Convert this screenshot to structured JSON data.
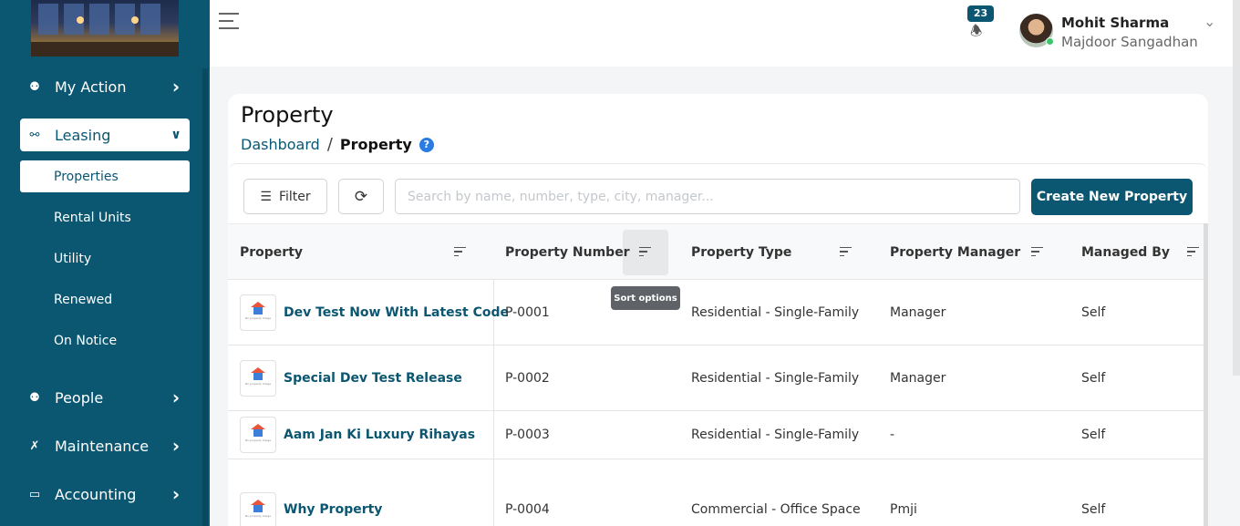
{
  "sidebar": {
    "nav": [
      {
        "label": "My Action",
        "icon": "user-icon"
      },
      {
        "label": "Leasing",
        "icon": "lock-icon"
      },
      {
        "label": "People",
        "icon": "people-icon"
      },
      {
        "label": "Maintenance",
        "icon": "tools-icon"
      },
      {
        "label": "Accounting",
        "icon": "wallet-icon"
      }
    ],
    "leasing_sub": [
      "Properties",
      "Rental Units",
      "Utility",
      "Renewed",
      "On Notice"
    ]
  },
  "header": {
    "notification_count": "23",
    "user_name": "Mohit Sharma",
    "user_org": "Majdoor Sangadhan"
  },
  "page": {
    "title": "Property",
    "breadcrumb": {
      "home": "Dashboard",
      "sep": "/",
      "current": "Property"
    },
    "help": "?"
  },
  "toolbar": {
    "filter_label": "Filter",
    "search_placeholder": "Search by name, number, type, city, manager...",
    "create_label": "Create New Property"
  },
  "table": {
    "columns": [
      "Property",
      "Property Number",
      "Property Type",
      "Property Manager",
      "Managed By"
    ],
    "tooltip": "Sort options",
    "thumb_text": "No property Image",
    "rows": [
      {
        "name": "Dev Test Now With Latest Code",
        "number": "P-0001",
        "type": "Residential - Single-Family",
        "manager": "Manager",
        "managed_by": "Self"
      },
      {
        "name": "Special Dev Test Release",
        "number": "P-0002",
        "type": "Residential - Single-Family",
        "manager": "Manager",
        "managed_by": "Self"
      },
      {
        "name": "Aam Jan Ki Luxury Rihayas",
        "number": "P-0003",
        "type": "Residential - Single-Family",
        "manager": "-",
        "managed_by": "Self"
      },
      {
        "name": "Why Property",
        "number": "P-0004",
        "type": "Commercial - Office Space",
        "manager": "Pmji",
        "managed_by": "Self"
      }
    ]
  },
  "colors": {
    "primary": "#0b5671",
    "badge": "#0b5671",
    "tooltip": "#5f6368"
  }
}
